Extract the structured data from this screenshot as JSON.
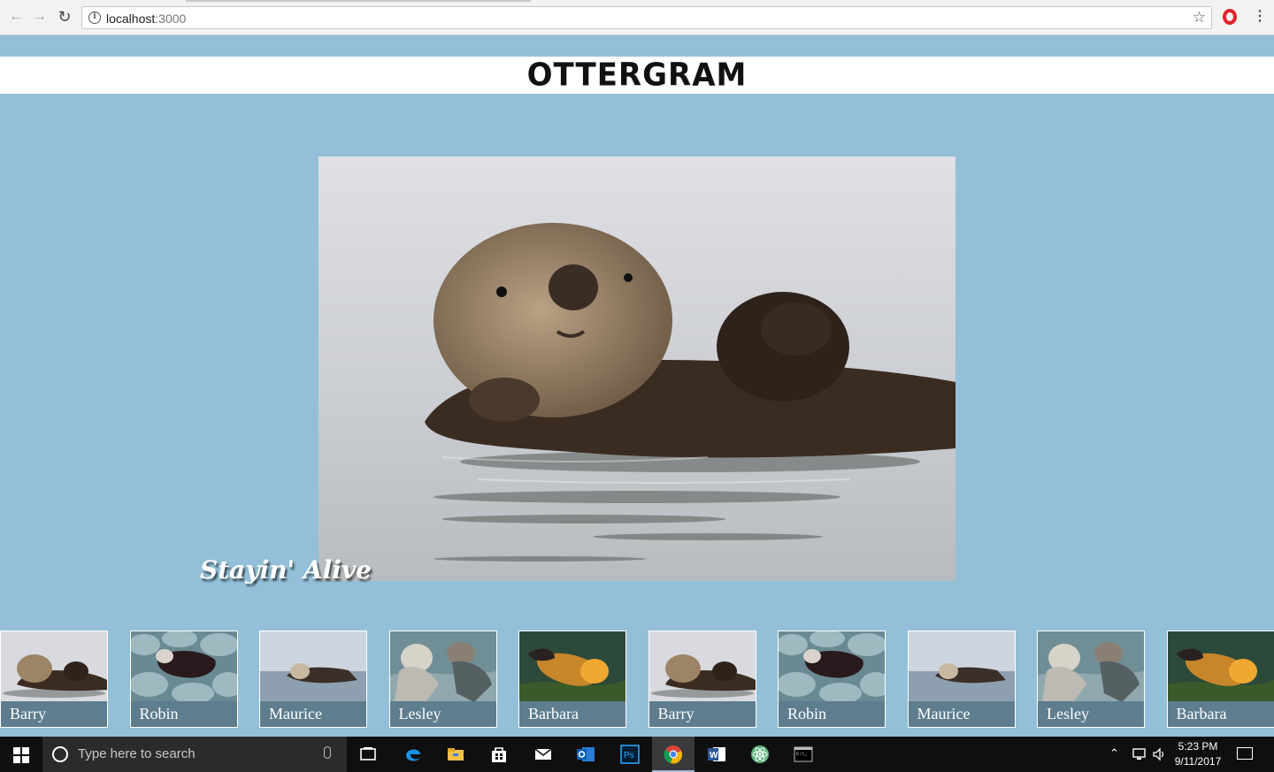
{
  "browser": {
    "url_host": "localhost",
    "url_port": ":3000"
  },
  "page": {
    "logo": "OTTERGRAM",
    "detail_title": "Stayin' Alive"
  },
  "thumbnails": [
    {
      "label": "Barry",
      "scene": "barry"
    },
    {
      "label": "Robin",
      "scene": "robin"
    },
    {
      "label": "Maurice",
      "scene": "maurice"
    },
    {
      "label": "Lesley",
      "scene": "lesley"
    },
    {
      "label": "Barbara",
      "scene": "barbara"
    },
    {
      "label": "Barry",
      "scene": "barry"
    },
    {
      "label": "Robin",
      "scene": "robin"
    },
    {
      "label": "Maurice",
      "scene": "maurice"
    },
    {
      "label": "Lesley",
      "scene": "lesley"
    },
    {
      "label": "Barbara",
      "scene": "barbara"
    }
  ],
  "taskbar": {
    "search_placeholder": "Type here to search",
    "time": "5:23 PM",
    "date": "9/11/2017",
    "apps": [
      "task-view",
      "edge",
      "file-explorer",
      "store",
      "mail",
      "outlook",
      "photoshop",
      "chrome",
      "word",
      "atom",
      "terminal"
    ]
  },
  "colors": {
    "page_bg": "#93c0d8",
    "label_bg": "#5e7d8e",
    "taskbar_bg": "#0f0f0f"
  }
}
